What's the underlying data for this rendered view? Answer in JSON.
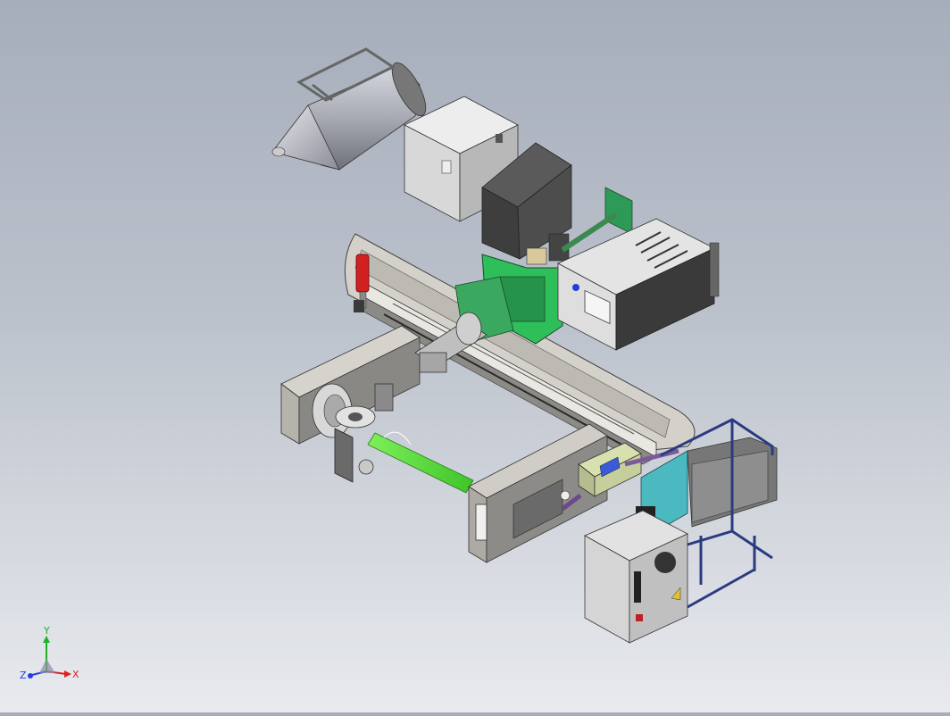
{
  "viewport": {
    "background_top": "#a6aebb",
    "background_bottom": "#e8eaee"
  },
  "model": {
    "components": [
      "hopper",
      "electrical-cabinet",
      "gearbox-housing",
      "green-motor-mount",
      "green-shaft-bracket",
      "control-box",
      "base-frame",
      "long-rail",
      "red-cylinder",
      "left-column",
      "rotary-head",
      "green-mandrel",
      "right-column",
      "operator-panel",
      "cyan-cabinet",
      "blue-rack",
      "power-cabinet"
    ],
    "colors": {
      "body_gray": "#c9c6c0",
      "dark_gray": "#4a4a4a",
      "motor_green": "#27a64f",
      "mandrel_green": "#6fe04a",
      "cylinder_red": "#d02020",
      "rack_blue": "#2c3a80",
      "panel_cyan": "#4cb8c0",
      "screen_blue": "#3a5ad8"
    }
  },
  "triad": {
    "x_label": "X",
    "y_label": "Y",
    "z_label": "Z",
    "x_color": "#e02020",
    "y_color": "#20b020",
    "z_color": "#2040e0"
  }
}
